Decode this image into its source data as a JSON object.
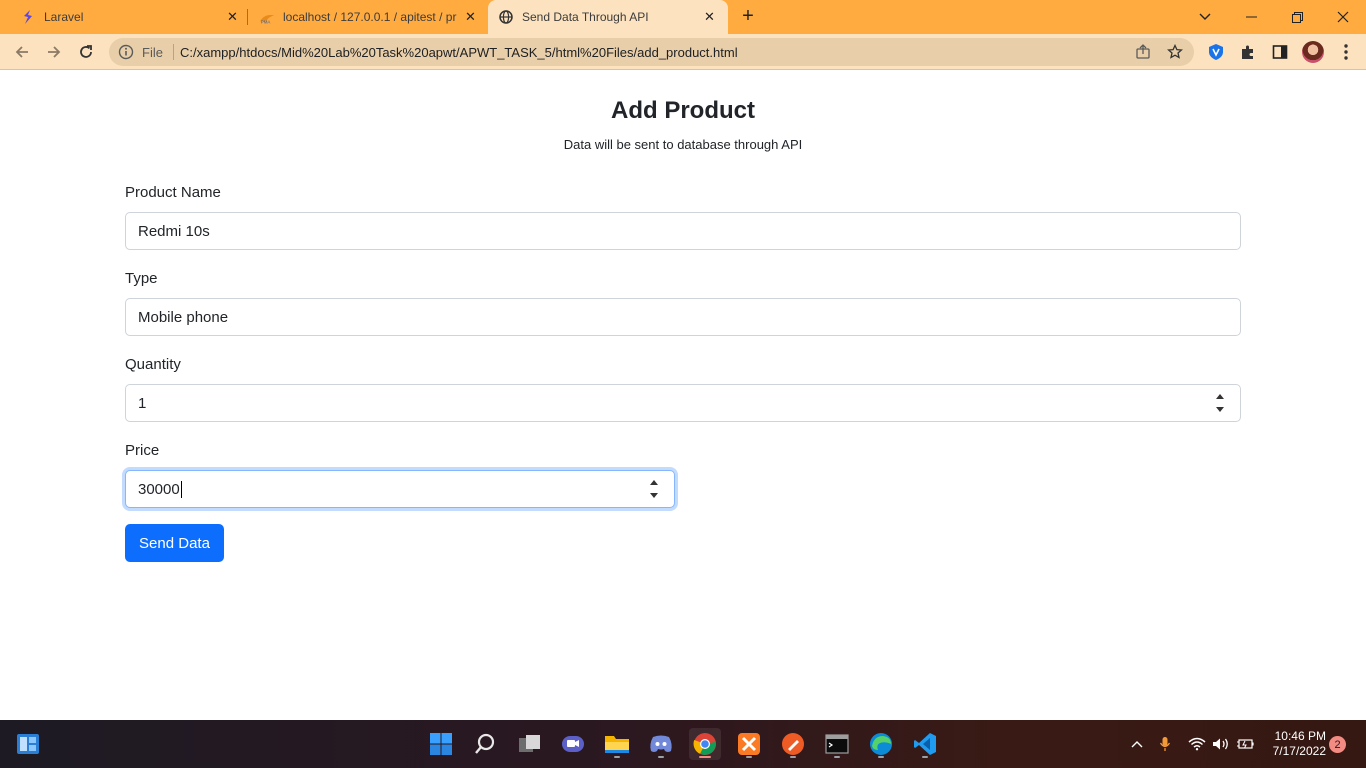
{
  "browser": {
    "tabs": [
      {
        "title": "Laravel",
        "favicon": "laravel-icon",
        "active": false
      },
      {
        "title": "localhost / 127.0.0.1 / apitest / pr",
        "favicon": "phpmyadmin-icon",
        "active": false
      },
      {
        "title": "Send Data Through API",
        "favicon": "globe-icon",
        "active": true
      }
    ],
    "omnibox": {
      "scheme_label": "File",
      "url": "C:/xampp/htdocs/Mid%20Lab%20Task%20apwt/APWT_TASK_5/html%20Files/add_product.html"
    }
  },
  "page": {
    "title": "Add Product",
    "subtitle": "Data will be sent to database through API",
    "fields": {
      "product_name": {
        "label": "Product Name",
        "value": "Redmi 10s"
      },
      "type": {
        "label": "Type",
        "value": "Mobile phone"
      },
      "quantity": {
        "label": "Quantity",
        "value": "1"
      },
      "price": {
        "label": "Price",
        "value": "30000"
      }
    },
    "submit_label": "Send Data"
  },
  "taskbar": {
    "apps": [
      "start-icon",
      "search-icon",
      "task-view-icon",
      "teams-chat-icon",
      "file-explorer-icon",
      "discord-icon",
      "chrome-icon",
      "xampp-icon",
      "postman-icon",
      "terminal-icon",
      "edge-icon",
      "vscode-icon"
    ],
    "time": "10:46 PM",
    "date": "7/17/2022",
    "notifications": "2"
  },
  "colors": {
    "tab_strip": "#ffab40",
    "toolbar": "#fce2bf",
    "primary_button": "#0d6efd"
  }
}
